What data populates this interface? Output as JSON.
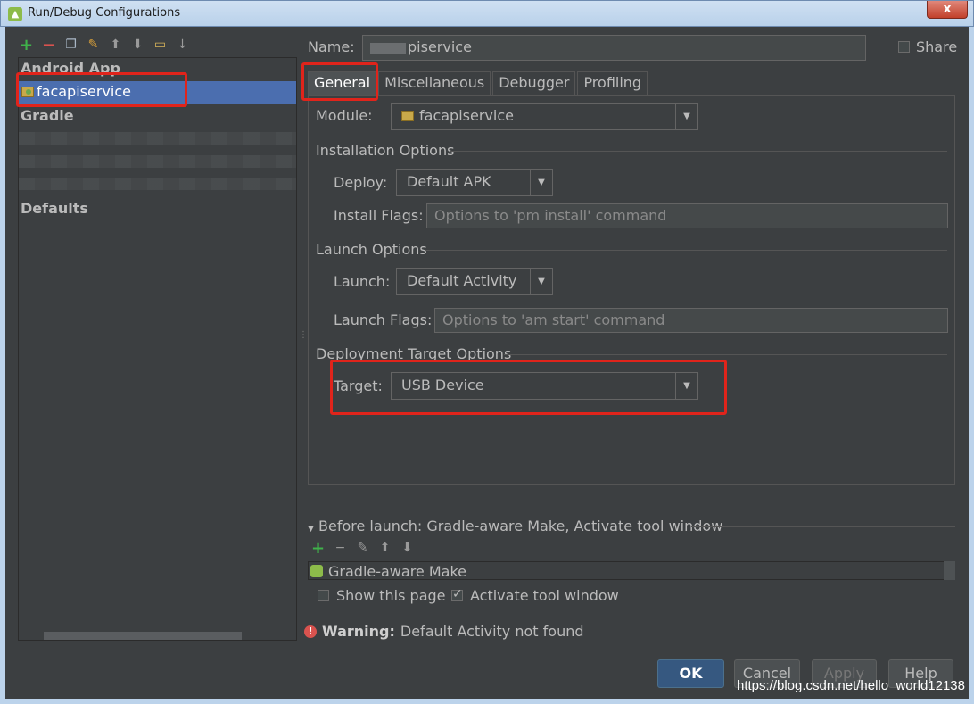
{
  "window": {
    "title": "Run/Debug Configurations",
    "close": "x"
  },
  "left_toolbar": {
    "icons": [
      "add-icon",
      "remove-icon",
      "copy-icon",
      "edit-defaults-icon",
      "move-up-icon",
      "move-down-icon",
      "folder-icon",
      "sort-icon"
    ]
  },
  "tree": {
    "groups": [
      "Android App",
      "Gradle",
      "Defaults"
    ],
    "selected_item": "facapiservice"
  },
  "name": {
    "label": "Name:",
    "value": "piservice"
  },
  "share": {
    "label": "Share",
    "checked": false
  },
  "tabs": [
    "General",
    "Miscellaneous",
    "Debugger",
    "Profiling"
  ],
  "active_tab": "General",
  "general": {
    "module_label": "Module:",
    "module_value": "facapiservice",
    "installation_options": "Installation Options",
    "deploy_label": "Deploy:",
    "deploy_value": "Default APK",
    "install_flags_label": "Install Flags:",
    "install_flags_placeholder": "Options to 'pm install' command",
    "launch_options": "Launch Options",
    "launch_label": "Launch:",
    "launch_value": "Default Activity",
    "launch_flags_label": "Launch Flags:",
    "launch_flags_placeholder": "Options to 'am start' command",
    "deployment_target_options": "Deployment Target Options",
    "target_label": "Target:",
    "target_value": "USB Device"
  },
  "before_launch": {
    "header": "Before launch: Gradle-aware Make, Activate tool window",
    "items": [
      "Gradle-aware Make"
    ],
    "show_this_page": "Show this page",
    "show_this_page_checked": false,
    "activate_tool_window": "Activate tool window",
    "activate_tool_window_checked": true
  },
  "warning": {
    "label": "Warning:",
    "text": "Default Activity not found"
  },
  "buttons": {
    "ok": "OK",
    "cancel": "Cancel",
    "apply": "Apply",
    "help": "Help"
  },
  "watermark": "https://blog.csdn.net/hello_world12138",
  "colors": {
    "accent": "#4b6eaf",
    "highlight": "#e0241b",
    "background": "#3c3f41"
  }
}
